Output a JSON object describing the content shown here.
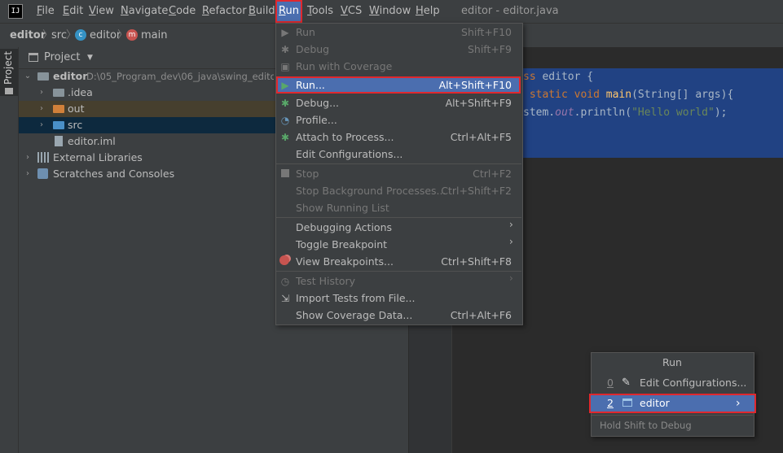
{
  "app": {
    "logo_text": "IJ",
    "window_title": "editor - editor.java"
  },
  "menubar": {
    "items": [
      {
        "label": "File",
        "u": "F",
        "rest": "ile"
      },
      {
        "label": "Edit",
        "u": "E",
        "rest": "dit"
      },
      {
        "label": "View",
        "u": "V",
        "rest": "iew"
      },
      {
        "label": "Navigate",
        "u": "N",
        "rest": "avigate"
      },
      {
        "label": "Code",
        "u": "C",
        "rest": "ode"
      },
      {
        "label": "Refactor",
        "u": "R",
        "rest": "efactor"
      },
      {
        "label": "Build",
        "u": "B",
        "rest": "uild"
      },
      {
        "label": "Run",
        "u": "R",
        "rest": "un"
      },
      {
        "label": "Tools",
        "u": "T",
        "rest": "ools"
      },
      {
        "label": "VCS",
        "u": "V",
        "rest": "CS"
      },
      {
        "label": "Window",
        "u": "W",
        "rest": "indow"
      },
      {
        "label": "Help",
        "u": "H",
        "rest": "elp"
      }
    ]
  },
  "breadcrumb": {
    "project": "editor",
    "folder": "src",
    "class": "editor",
    "method": "main"
  },
  "stripe": {
    "project_tab": "Project"
  },
  "project_panel": {
    "title": "Project",
    "tree": {
      "root_name": "editor",
      "root_path": "D:\\05_Program_dev\\06_java\\swing_editor",
      "idea": ".idea",
      "out": "out",
      "src": "src",
      "iml": "editor.iml",
      "ext_libs": "External Libraries",
      "scratches": "Scratches and Consoles"
    }
  },
  "editor": {
    "line1": {
      "kw": "ss",
      "rest": " editor {"
    },
    "line2": {
      "kw": " static void",
      "fn": "main",
      "rest": "(String[] args){"
    },
    "line3": {
      "pre": "stem.",
      "fld": "out",
      "mid": ".println(",
      "str": "\"Hello world\"",
      "end": ");"
    }
  },
  "run_menu": {
    "items": [
      {
        "label": "Run",
        "shortcut": "Shift+F10",
        "disabled": true
      },
      {
        "label": "Debug",
        "shortcut": "Shift+F9",
        "disabled": true
      },
      {
        "label": "Run with Coverage",
        "shortcut": "",
        "disabled": true
      },
      {
        "label": "Run...",
        "shortcut": "Alt+Shift+F10",
        "disabled": false
      },
      {
        "label": "Debug...",
        "shortcut": "Alt+Shift+F9",
        "disabled": false
      },
      {
        "label": "Profile...",
        "shortcut": "",
        "disabled": false
      },
      {
        "label": "Attach to Process...",
        "shortcut": "Ctrl+Alt+F5",
        "disabled": false
      },
      {
        "label": "Edit Configurations...",
        "shortcut": "",
        "disabled": false
      },
      {
        "label": "Stop",
        "shortcut": "Ctrl+F2",
        "disabled": true
      },
      {
        "label": "Stop Background Processes...",
        "shortcut": "Ctrl+Shift+F2",
        "disabled": true
      },
      {
        "label": "Show Running List",
        "shortcut": "",
        "disabled": true
      },
      {
        "label": "Debugging Actions",
        "shortcut": "",
        "disabled": false
      },
      {
        "label": "Toggle Breakpoint",
        "shortcut": "",
        "disabled": false
      },
      {
        "label": "View Breakpoints...",
        "shortcut": "Ctrl+Shift+F8",
        "disabled": false
      },
      {
        "label": "Test History",
        "shortcut": "",
        "disabled": true
      },
      {
        "label": "Import Tests from File...",
        "shortcut": "",
        "disabled": false
      },
      {
        "label": "Show Coverage Data...",
        "shortcut": "Ctrl+Alt+F6",
        "disabled": false
      }
    ]
  },
  "run_popup": {
    "title": "Run",
    "items": [
      {
        "index": "0",
        "label": "Edit Configurations..."
      },
      {
        "index": "2",
        "label": "editor"
      }
    ],
    "footer": "Hold Shift to Debug"
  },
  "colors": {
    "selection": "#4b6eaf",
    "highlight_border": "#e0282e",
    "panel_bg": "#3c3f41",
    "editor_bg": "#2b2b2b"
  }
}
